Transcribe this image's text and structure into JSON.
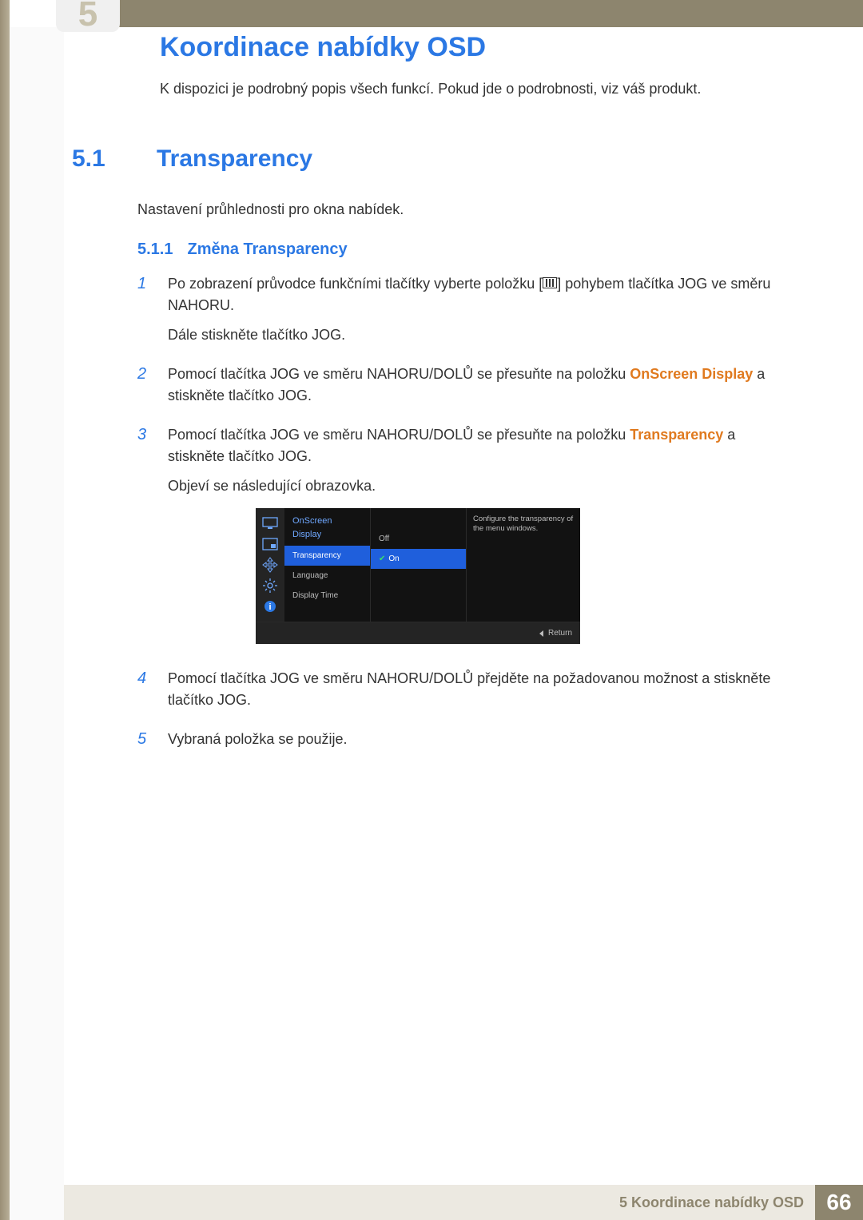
{
  "chapter": {
    "number": "5",
    "title": "Koordinace nabídky OSD",
    "intro": "K dispozici je podrobný popis všech funkcí. Pokud jde o podrobnosti, viz váš produkt."
  },
  "section": {
    "number": "5.1",
    "title": "Transparency",
    "intro": "Nastavení průhlednosti pro okna nabídek.",
    "subsection": {
      "number": "5.1.1",
      "title": "Změna Transparency"
    }
  },
  "steps": {
    "s1a": "Po zobrazení průvodce funkčními tlačítky vyberte položku [",
    "s1b": "] pohybem tlačítka JOG ve směru NAHORU.",
    "s1c": "Dále stiskněte tlačítko JOG.",
    "s2a": "Pomocí tlačítka JOG ve směru NAHORU/DOLŮ se přesuňte na položku ",
    "s2hl": "OnScreen Display",
    "s2b": " a stiskněte tlačítko JOG.",
    "s3a": "Pomocí tlačítka JOG ve směru NAHORU/DOLŮ se přesuňte na položku ",
    "s3hl": "Transparency",
    "s3b": " a stiskněte tlačítko JOG.",
    "s3c": "Objeví se následující obrazovka.",
    "s4": "Pomocí tlačítka JOG ve směru NAHORU/DOLŮ přejděte na požadovanou možnost a stiskněte tlačítko JOG.",
    "s5": "Vybraná položka se použije."
  },
  "osd": {
    "header": "OnScreen Display",
    "menu_items": [
      "Transparency",
      "Language",
      "Display Time"
    ],
    "options": [
      "Off",
      "On"
    ],
    "selected_menu_index": 0,
    "selected_option_index": 1,
    "help_text": "Configure the transparency of the menu windows.",
    "return_label": "Return"
  },
  "footer": {
    "text": "5 Koordinace nabídky OSD",
    "page": "66"
  }
}
